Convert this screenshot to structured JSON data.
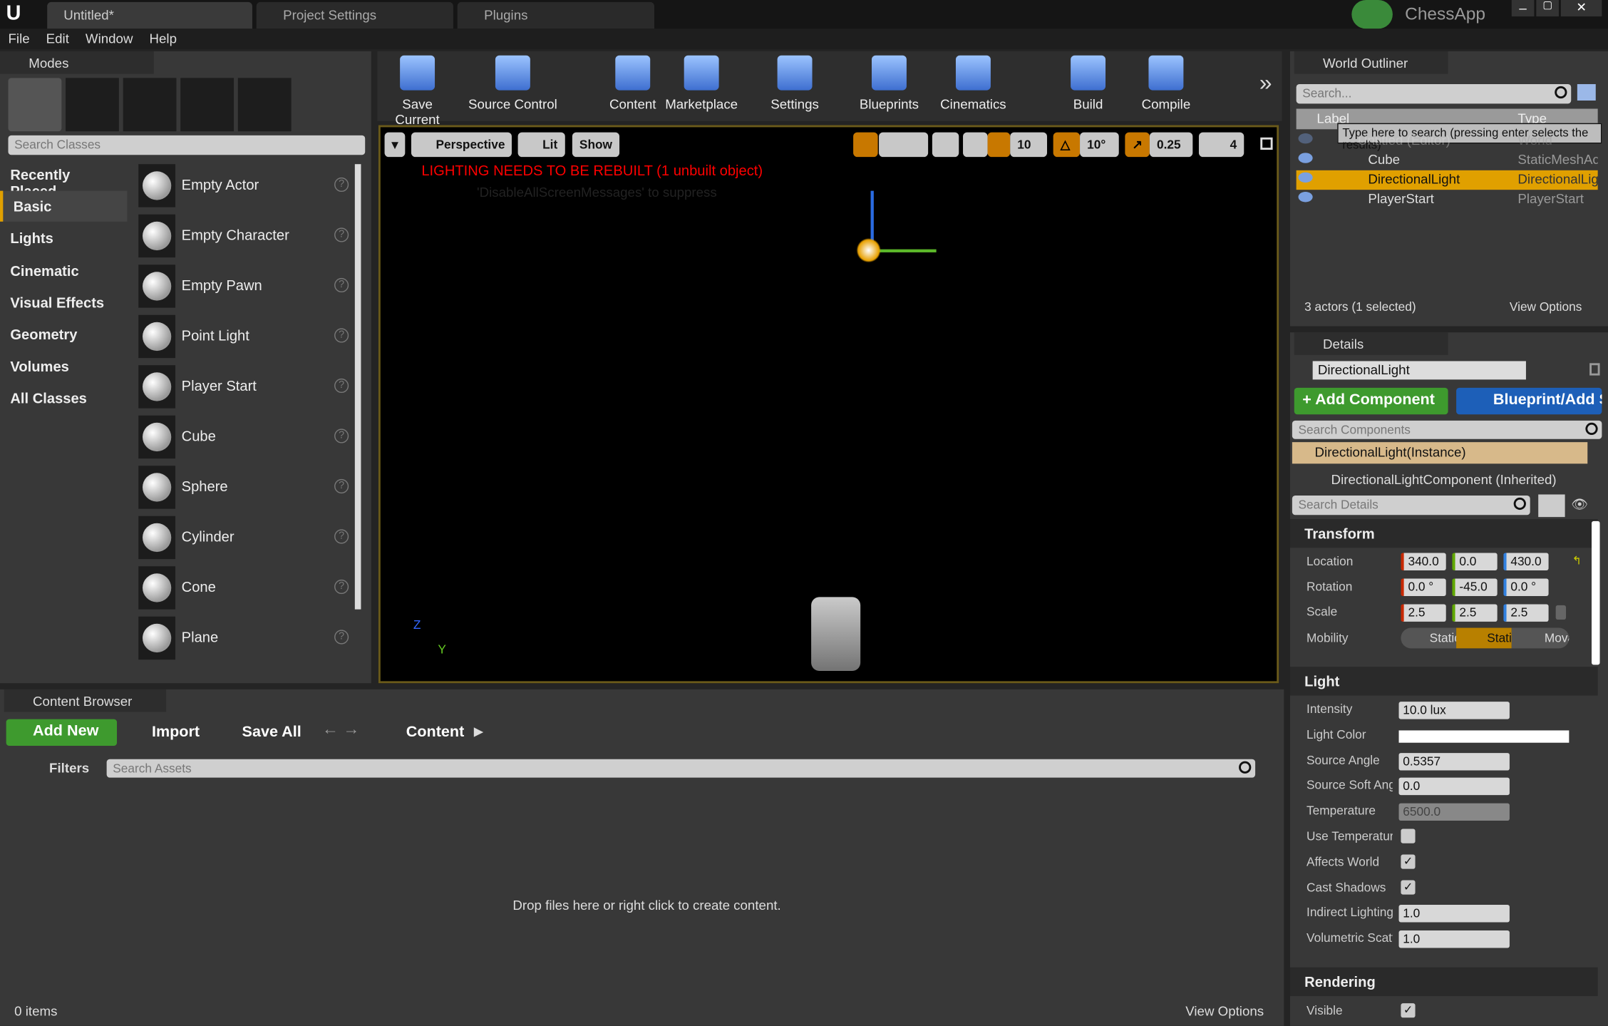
{
  "titlebar": {
    "tabs": [
      "Untitled*",
      "Project Settings",
      "Plugins"
    ],
    "app_name": "ChessApp"
  },
  "menu": [
    "File",
    "Edit",
    "Window",
    "Help"
  ],
  "modes": {
    "title": "Modes",
    "search_placeholder": "Search Classes",
    "categories": [
      "Recently Placed",
      "Basic",
      "Lights",
      "Cinematic",
      "Visual Effects",
      "Geometry",
      "Volumes",
      "All Classes"
    ],
    "selected_category": "Basic",
    "items": [
      "Empty Actor",
      "Empty Character",
      "Empty Pawn",
      "Point Light",
      "Player Start",
      "Cube",
      "Sphere",
      "Cylinder",
      "Cone",
      "Plane"
    ]
  },
  "toolbar": {
    "buttons": [
      "Save Current",
      "Source Control",
      "Content",
      "Marketplace",
      "Settings",
      "Blueprints",
      "Cinematics",
      "Build",
      "Compile"
    ]
  },
  "viewport": {
    "perspective": "Perspective",
    "lit": "Lit",
    "show": "Show",
    "grid_snap": "10",
    "rot_snap": "10°",
    "scale_snap": "0.25",
    "camera_speed": "4",
    "warning": "LIGHTING NEEDS TO BE REBUILT (1 unbuilt object)",
    "suppress_hint": "'DisableAllScreenMessages' to suppress",
    "axis_z": "Z",
    "axis_y": "Y"
  },
  "outliner": {
    "title": "World Outliner",
    "search_placeholder": "Search...",
    "tooltip": "Type here to search (pressing enter selects the results)",
    "col_label": "Label",
    "col_type": "Type",
    "rows": [
      {
        "label": "Untitled (Editor)",
        "type": "World"
      },
      {
        "label": "Cube",
        "type": "StaticMeshActor"
      },
      {
        "label": "DirectionalLight",
        "type": "DirectionalLight"
      },
      {
        "label": "PlayerStart",
        "type": "PlayerStart"
      }
    ],
    "status": "3 actors (1 selected)",
    "view_options": "View Options"
  },
  "details": {
    "title": "Details",
    "name": "DirectionalLight",
    "add_component": "+ Add Component",
    "blueprint": "Blueprint/Add Script",
    "search_components": "Search Components",
    "instance": "DirectionalLight(Instance)",
    "component": "DirectionalLightComponent (Inherited)",
    "search_details": "Search Details",
    "transform": {
      "title": "Transform",
      "location_label": "Location",
      "location": [
        "340.0",
        "0.0",
        "430.0"
      ],
      "rotation_label": "Rotation",
      "rotation": [
        "0.0 °",
        "-45.0",
        "0.0 °"
      ],
      "scale_label": "Scale",
      "scale": [
        "2.5",
        "2.5",
        "2.5"
      ],
      "mobility_label": "Mobility",
      "mobility": [
        "Static",
        "Stationary",
        "Movable"
      ]
    },
    "light": {
      "title": "Light",
      "props": [
        {
          "label": "Intensity",
          "value": "10.0 lux"
        },
        {
          "label": "Light Color",
          "value": ""
        },
        {
          "label": "Source Angle",
          "value": "0.5357"
        },
        {
          "label": "Source Soft Angle",
          "value": "0.0"
        },
        {
          "label": "Temperature",
          "value": "6500.0"
        },
        {
          "label": "Use Temperature",
          "checked": false
        },
        {
          "label": "Affects World",
          "checked": true
        },
        {
          "label": "Cast Shadows",
          "checked": true
        },
        {
          "label": "Indirect Lighting Intensity",
          "value": "1.0"
        },
        {
          "label": "Volumetric Scattering Intensity",
          "value": "1.0"
        }
      ]
    },
    "rendering": {
      "title": "Rendering",
      "visible_label": "Visible",
      "visible": true
    }
  },
  "content_browser": {
    "title": "Content Browser",
    "add_new": "Add New",
    "import": "Import",
    "save_all": "Save All",
    "path": "Content",
    "filters": "Filters",
    "search_placeholder": "Search Assets",
    "empty_hint": "Drop files here or right click to create content.",
    "count": "0 items",
    "view_options": "View Options"
  }
}
